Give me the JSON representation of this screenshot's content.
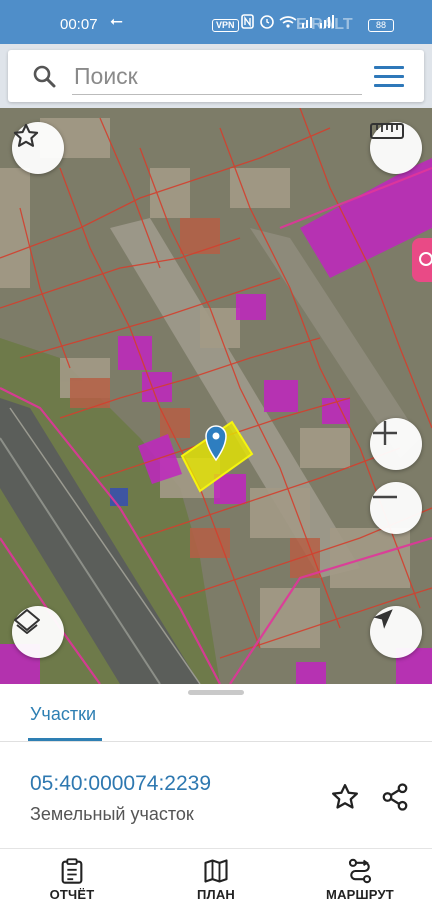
{
  "status_bar": {
    "time": "00:07",
    "arrow": "⭠",
    "vpn": "VPN",
    "battery": "88",
    "watermark": "E  RALT",
    "icons": [
      "nfc-icon",
      "alarm-icon",
      "wifi-icon",
      "lte-signal-icon",
      "signal-icon"
    ]
  },
  "search": {
    "placeholder": "Поиск"
  },
  "map": {
    "selected_parcel_color": "#e6e600",
    "highlight_color": "#c026c0",
    "boundary_color": "#d3402e"
  },
  "sheet": {
    "tab_label": "Участки",
    "cadastral_number": "05:40:000074:2239",
    "parcel_type": "Земельный участок"
  },
  "bottom_nav": {
    "items": [
      {
        "label": "ОТЧЁТ",
        "icon": "clipboard-icon"
      },
      {
        "label": "ПЛАН",
        "icon": "map-icon"
      },
      {
        "label": "МАРШРУТ",
        "icon": "route-icon"
      }
    ]
  },
  "colors": {
    "status_bar": "#4f8ec9",
    "accent": "#2e7fb3"
  }
}
